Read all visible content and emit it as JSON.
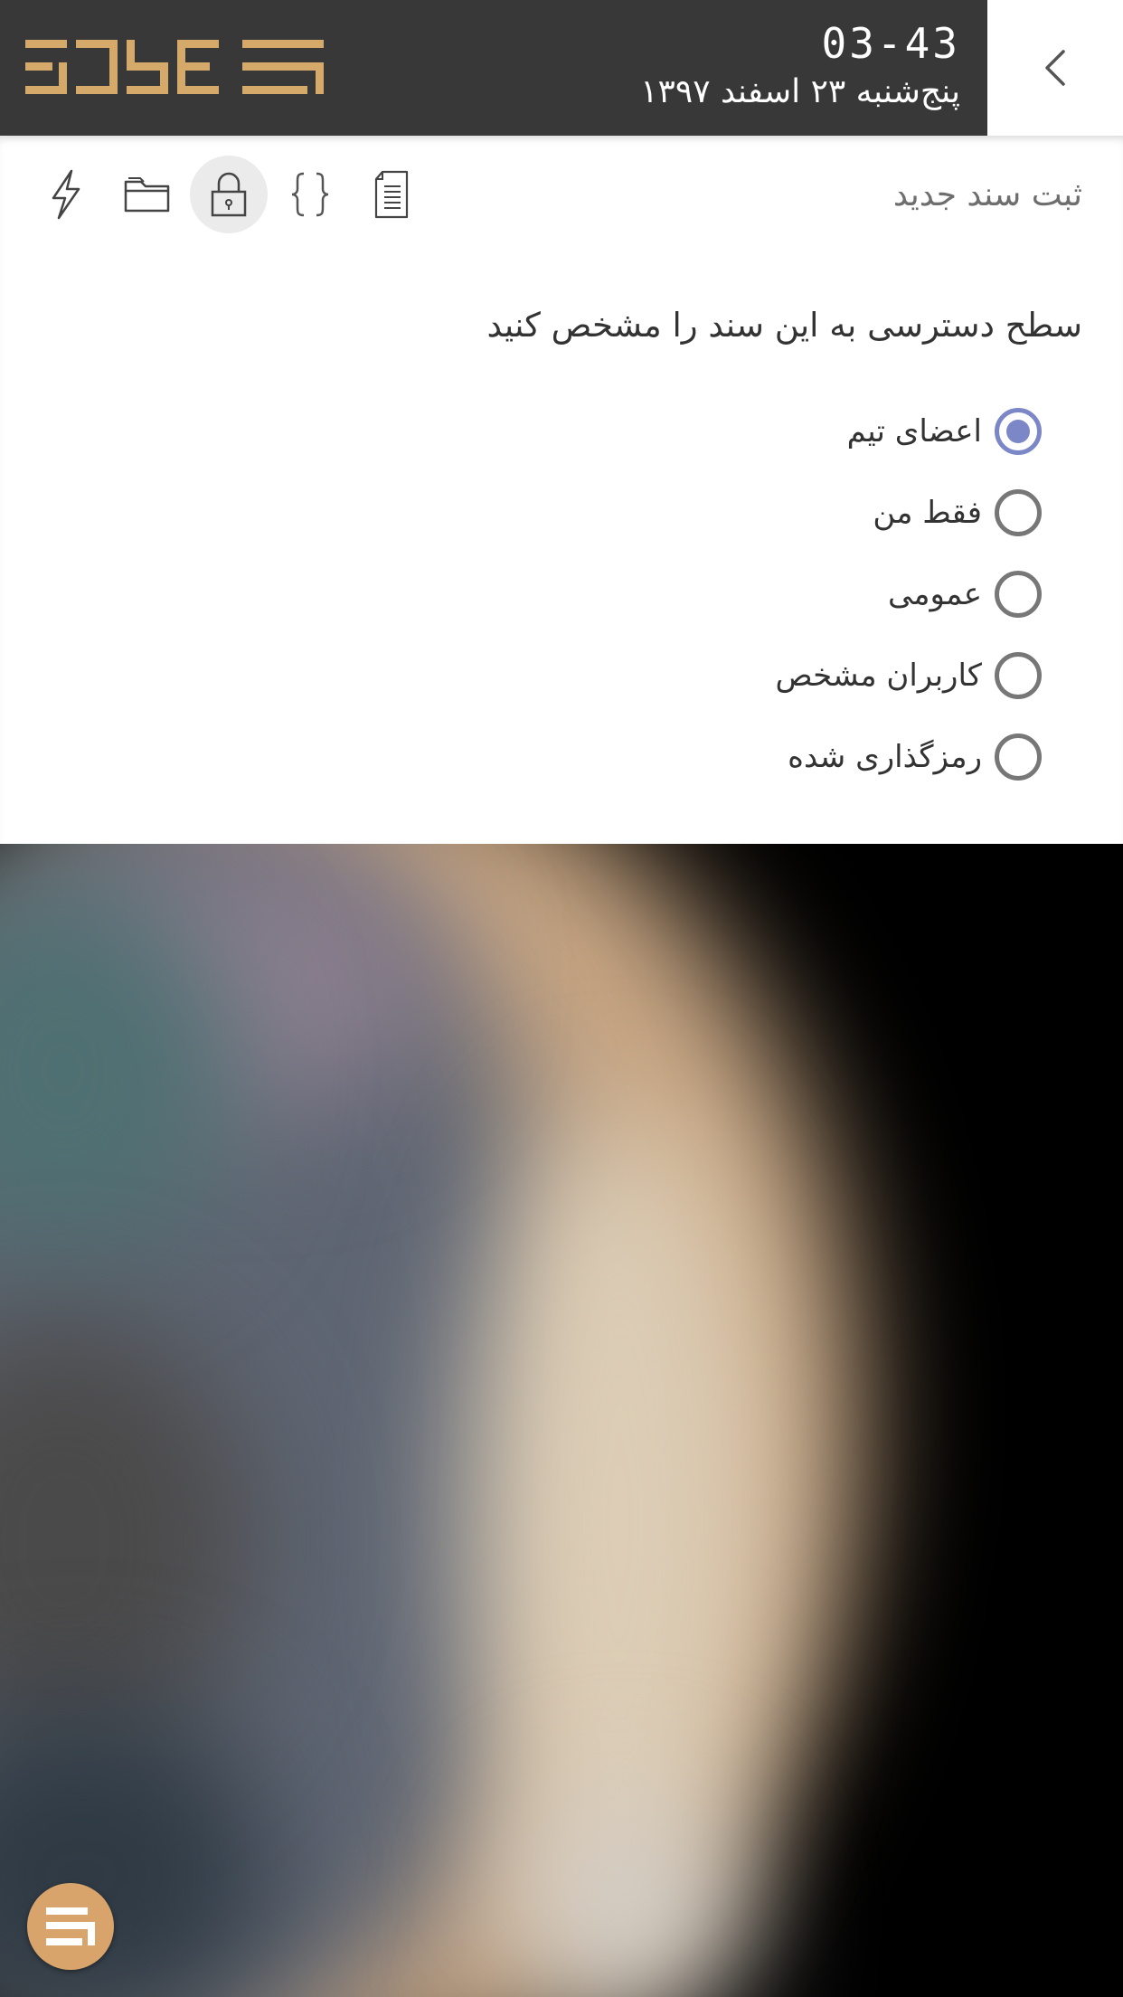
{
  "header": {
    "clock": "03-43",
    "date": "پنج‌شنبه ۲۳ اسفند ۱۳۹۷",
    "brand_color": "#d4a96a"
  },
  "panel": {
    "title": "ثبت سند جدید",
    "toolbar": [
      {
        "name": "document-icon"
      },
      {
        "name": "braces-icon"
      },
      {
        "name": "lock-icon",
        "active": true
      },
      {
        "name": "folder-icon"
      },
      {
        "name": "lightning-icon"
      }
    ],
    "question": "سطح دسترسی به این سند را مشخص کنید",
    "options": [
      {
        "label": "اعضای تیم",
        "checked": true
      },
      {
        "label": "فقط من",
        "checked": false
      },
      {
        "label": "عمومی",
        "checked": false
      },
      {
        "label": "کاربران مشخص",
        "checked": false
      },
      {
        "label": "رمزگذاری شده",
        "checked": false
      }
    ],
    "accent_color": "#7b87c7"
  }
}
